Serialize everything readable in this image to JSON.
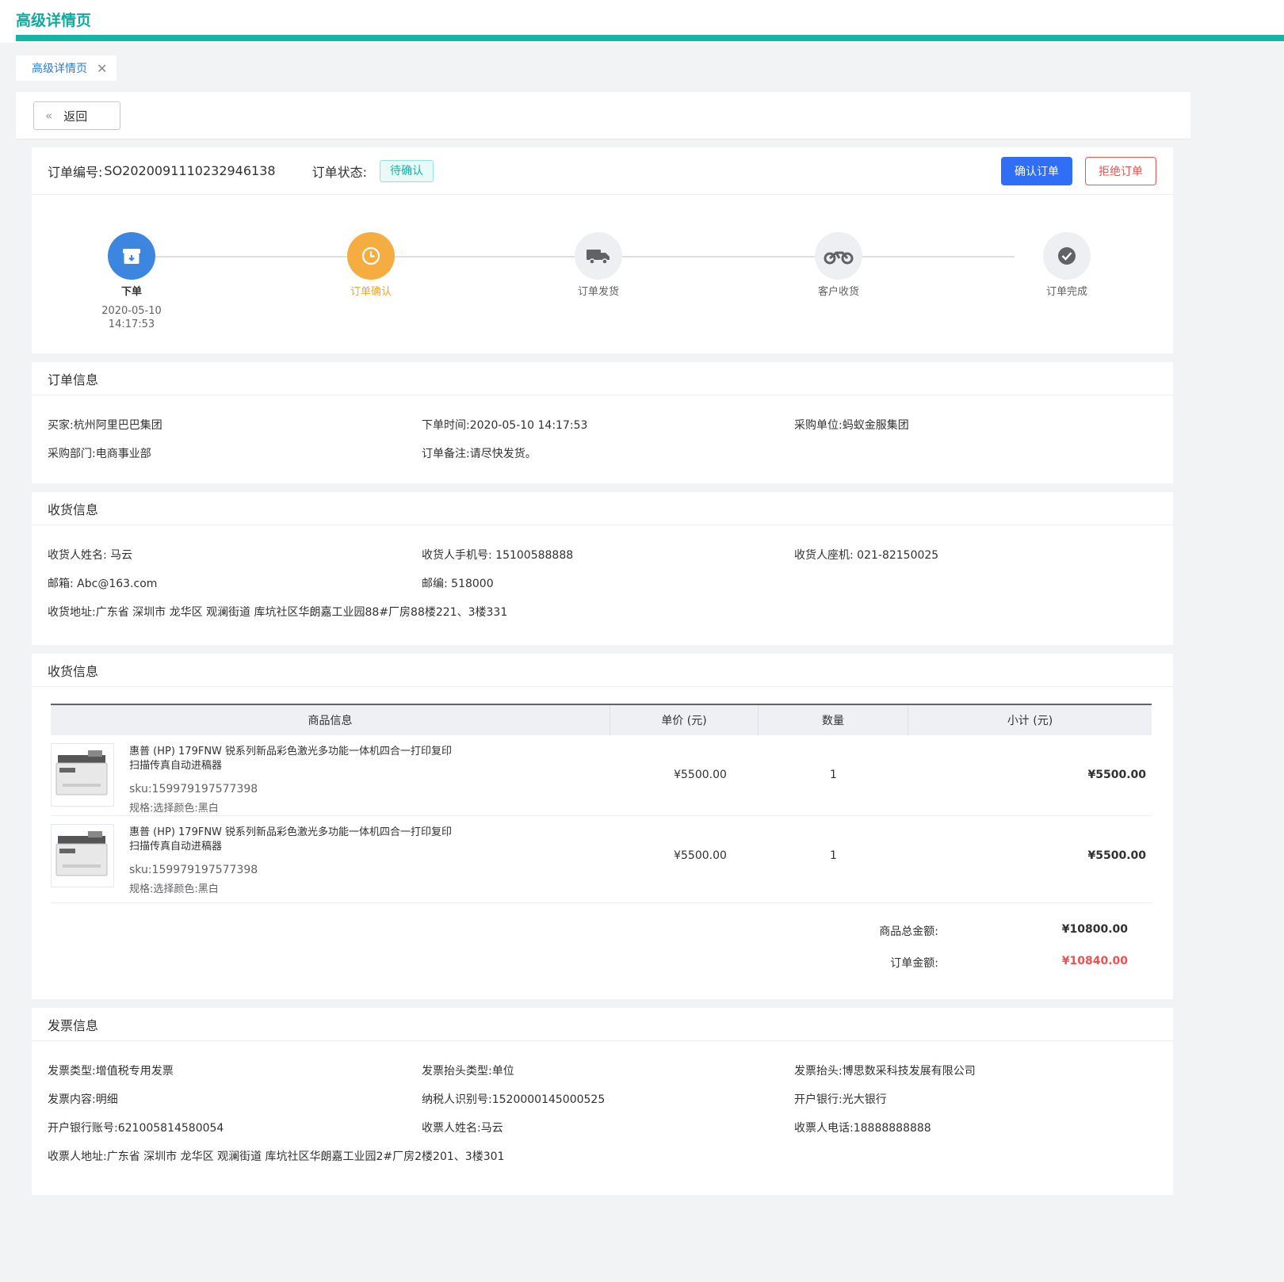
{
  "page_title": "高级详情页",
  "tab": {
    "label": "高级详情页",
    "close": "✕"
  },
  "back_button": {
    "label": "返回"
  },
  "order": {
    "no_label": "订单编号:",
    "no_value": "SO2020091110232946138",
    "status_label": "订单状态:",
    "status_value": "待确认",
    "confirm_label": "确认订单",
    "reject_label": "拒绝订单"
  },
  "steps": [
    {
      "name": "下单",
      "date": "2020-05-10",
      "time": "14:17:53",
      "state": "done",
      "icon": "archive-icon"
    },
    {
      "name": "订单确认",
      "state": "active",
      "icon": "clock-icon"
    },
    {
      "name": "订单发货",
      "state": "pending",
      "icon": "truck-icon"
    },
    {
      "name": "客户收货",
      "state": "pending",
      "icon": "motorbike-icon"
    },
    {
      "name": "订单完成",
      "state": "pending",
      "icon": "check-icon"
    }
  ],
  "order_info": {
    "title": "订单信息",
    "buyer": "买家:杭州阿里巴巴集团",
    "order_time": "下单时间:2020-05-10 14:17:53",
    "purchase_unit": "采购单位:蚂蚁金服集团",
    "purchase_dept": "采购部门:电商事业部",
    "remark": "订单备注:请尽快发货。"
  },
  "receiver_info": {
    "title": "收货信息",
    "name": "收货人姓名:  马云",
    "phone": "收货人手机号:  15100588888",
    "landline": "收货人座机:  021-82150025",
    "email": "邮箱:  Abc@163.com",
    "zip": "邮编:  518000",
    "address": "收货地址:广东省 深圳市 龙华区 观澜街道 库坑社区华朗嘉工业园88#厂房88楼221、3楼331"
  },
  "goods": {
    "title": "收货信息",
    "headers": [
      "商品信息",
      "单价 (元)",
      "数量",
      "小计 (元)"
    ],
    "rows": [
      {
        "name": "惠普 (HP) 179FNW 锐系列新品彩色激光多功能一体机四合一打印复印扫描传真自动进稿器",
        "sku": "sku:159979197577398",
        "spec": "规格:选择颜色:黑白",
        "price": "¥5500.00",
        "qty": "1",
        "subtotal": "¥5500.00"
      },
      {
        "name": "惠普 (HP) 179FNW 锐系列新品彩色激光多功能一体机四合一打印复印扫描传真自动进稿器",
        "sku": "sku:159979197577398",
        "spec": "规格:选择颜色:黑白",
        "price": "¥5500.00",
        "qty": "1",
        "subtotal": "¥5500.00"
      }
    ],
    "total_label": "商品总金额:",
    "total_value": "¥10800.00",
    "order_amount_label": "订单金额:",
    "order_amount_value": "¥10840.00"
  },
  "invoice_info": {
    "title": "发票信息",
    "type": "发票类型:增值税专用发票",
    "header_type": "发票抬头类型:单位",
    "header": "发票抬头:博思数采科技发展有限公司",
    "content": "发票内容:明细",
    "tax_id": "纳税人识别号:1520000145000525",
    "bank": "开户银行:光大银行",
    "account": "开户银行账号:621005814580054",
    "receiver_name": "收票人姓名:马云",
    "receiver_phone": "收票人电话:18888888888",
    "receiver_address": "收票人地址:广东省 深圳市 龙华区 观澜街道 库坑社区华朗嘉工业园2#厂房2楼201、3楼301"
  },
  "colors": {
    "accent": "#13b5a6",
    "primary": "#2f6ef5",
    "danger": "#f05050",
    "step_done": "#3c86e0",
    "step_active": "#f5ad42",
    "amount_red": "#f05050"
  }
}
